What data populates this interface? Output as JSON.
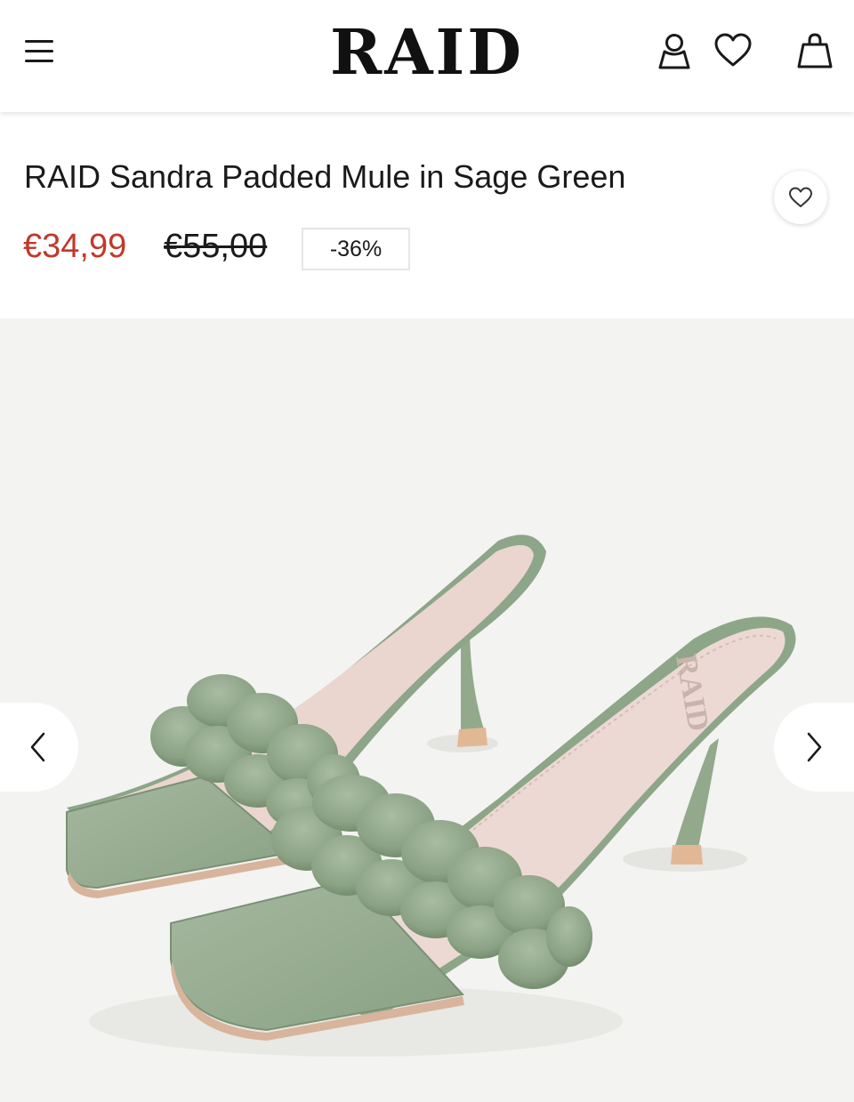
{
  "header": {
    "logo": "RAID",
    "icons": [
      "menu-icon",
      "account-icon",
      "heart-icon",
      "bag-icon"
    ]
  },
  "product": {
    "title": "RAID Sandra Padded Mule in Sage Green",
    "price_sale": "€34,99",
    "price_original": "€55,00",
    "discount": "-36%",
    "image_brand_print": "RAID"
  },
  "colors": {
    "sale_price": "#c0392b",
    "sage_green": "#8fa68a",
    "insole": "#ecd9d3",
    "background": "#f3f3f2"
  },
  "gallery": {
    "prev_icon": "chevron-left-icon",
    "next_icon": "chevron-right-icon"
  }
}
